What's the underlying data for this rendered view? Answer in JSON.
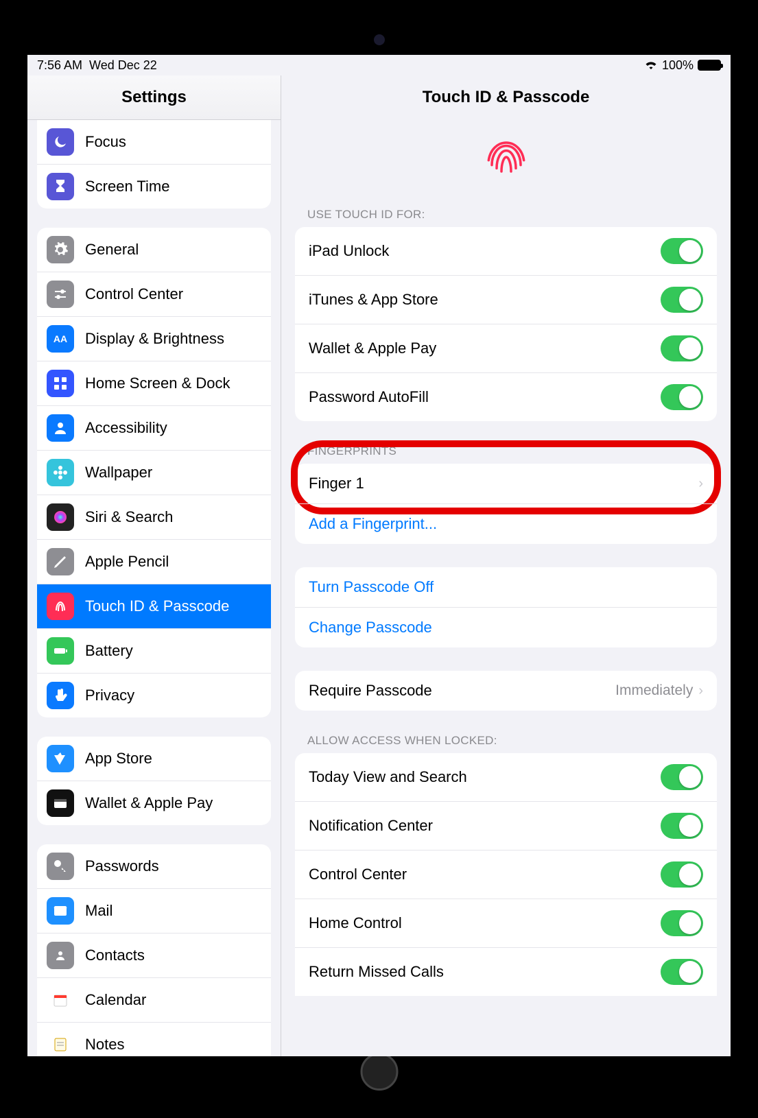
{
  "status": {
    "time": "7:56 AM",
    "date": "Wed Dec 22",
    "battery": "100%"
  },
  "sidebar": {
    "title": "Settings",
    "groups": [
      [
        {
          "name": "focus",
          "label": "Focus",
          "icon": "moon",
          "bg": "#5856d6"
        },
        {
          "name": "screen-time",
          "label": "Screen Time",
          "icon": "hourglass",
          "bg": "#5856d6"
        }
      ],
      [
        {
          "name": "general",
          "label": "General",
          "icon": "gear",
          "bg": "#8e8e93"
        },
        {
          "name": "control-center",
          "label": "Control Center",
          "icon": "sliders",
          "bg": "#8e8e93"
        },
        {
          "name": "display",
          "label": "Display & Brightness",
          "icon": "aa",
          "bg": "#0a7aff"
        },
        {
          "name": "home-screen",
          "label": "Home Screen & Dock",
          "icon": "grid",
          "bg": "#3355ff"
        },
        {
          "name": "accessibility",
          "label": "Accessibility",
          "icon": "person",
          "bg": "#0a7aff"
        },
        {
          "name": "wallpaper",
          "label": "Wallpaper",
          "icon": "flower",
          "bg": "#35c4dc"
        },
        {
          "name": "siri",
          "label": "Siri & Search",
          "icon": "siri",
          "bg": "#222"
        },
        {
          "name": "pencil",
          "label": "Apple Pencil",
          "icon": "pencil",
          "bg": "#8e8e93"
        },
        {
          "name": "touchid",
          "label": "Touch ID & Passcode",
          "icon": "finger",
          "bg": "#ff2d55",
          "selected": true
        },
        {
          "name": "battery",
          "label": "Battery",
          "icon": "battery",
          "bg": "#34c759"
        },
        {
          "name": "privacy",
          "label": "Privacy",
          "icon": "hand",
          "bg": "#0a7aff"
        }
      ],
      [
        {
          "name": "app-store",
          "label": "App Store",
          "icon": "astore",
          "bg": "#1e90ff"
        },
        {
          "name": "wallet",
          "label": "Wallet & Apple Pay",
          "icon": "wallet",
          "bg": "#111"
        }
      ],
      [
        {
          "name": "passwords",
          "label": "Passwords",
          "icon": "key",
          "bg": "#8e8e93"
        },
        {
          "name": "mail",
          "label": "Mail",
          "icon": "mail",
          "bg": "#1e90ff"
        },
        {
          "name": "contacts",
          "label": "Contacts",
          "icon": "contacts",
          "bg": "#8e8e93"
        },
        {
          "name": "calendar",
          "label": "Calendar",
          "icon": "calendar",
          "bg": "#fff"
        },
        {
          "name": "notes",
          "label": "Notes",
          "icon": "notes",
          "bg": "#fff"
        }
      ]
    ]
  },
  "detail": {
    "title": "Touch ID & Passcode",
    "sections": {
      "useFor": {
        "label": "USE TOUCH ID FOR:",
        "items": [
          {
            "label": "iPad Unlock"
          },
          {
            "label": "iTunes & App Store"
          },
          {
            "label": "Wallet & Apple Pay"
          },
          {
            "label": "Password AutoFill"
          }
        ]
      },
      "fingerprints": {
        "label": "FINGERPRINTS",
        "items": [
          {
            "label": "Finger 1",
            "type": "nav"
          },
          {
            "label": "Add a Fingerprint...",
            "type": "link"
          }
        ]
      },
      "passcode": {
        "items": [
          {
            "label": "Turn Passcode Off",
            "type": "link"
          },
          {
            "label": "Change Passcode",
            "type": "link"
          }
        ]
      },
      "require": {
        "label": "Require Passcode",
        "value": "Immediately"
      },
      "allow": {
        "label": "ALLOW ACCESS WHEN LOCKED:",
        "items": [
          {
            "label": "Today View and Search"
          },
          {
            "label": "Notification Center"
          },
          {
            "label": "Control Center"
          },
          {
            "label": "Home Control"
          },
          {
            "label": "Return Missed Calls"
          }
        ]
      }
    }
  }
}
